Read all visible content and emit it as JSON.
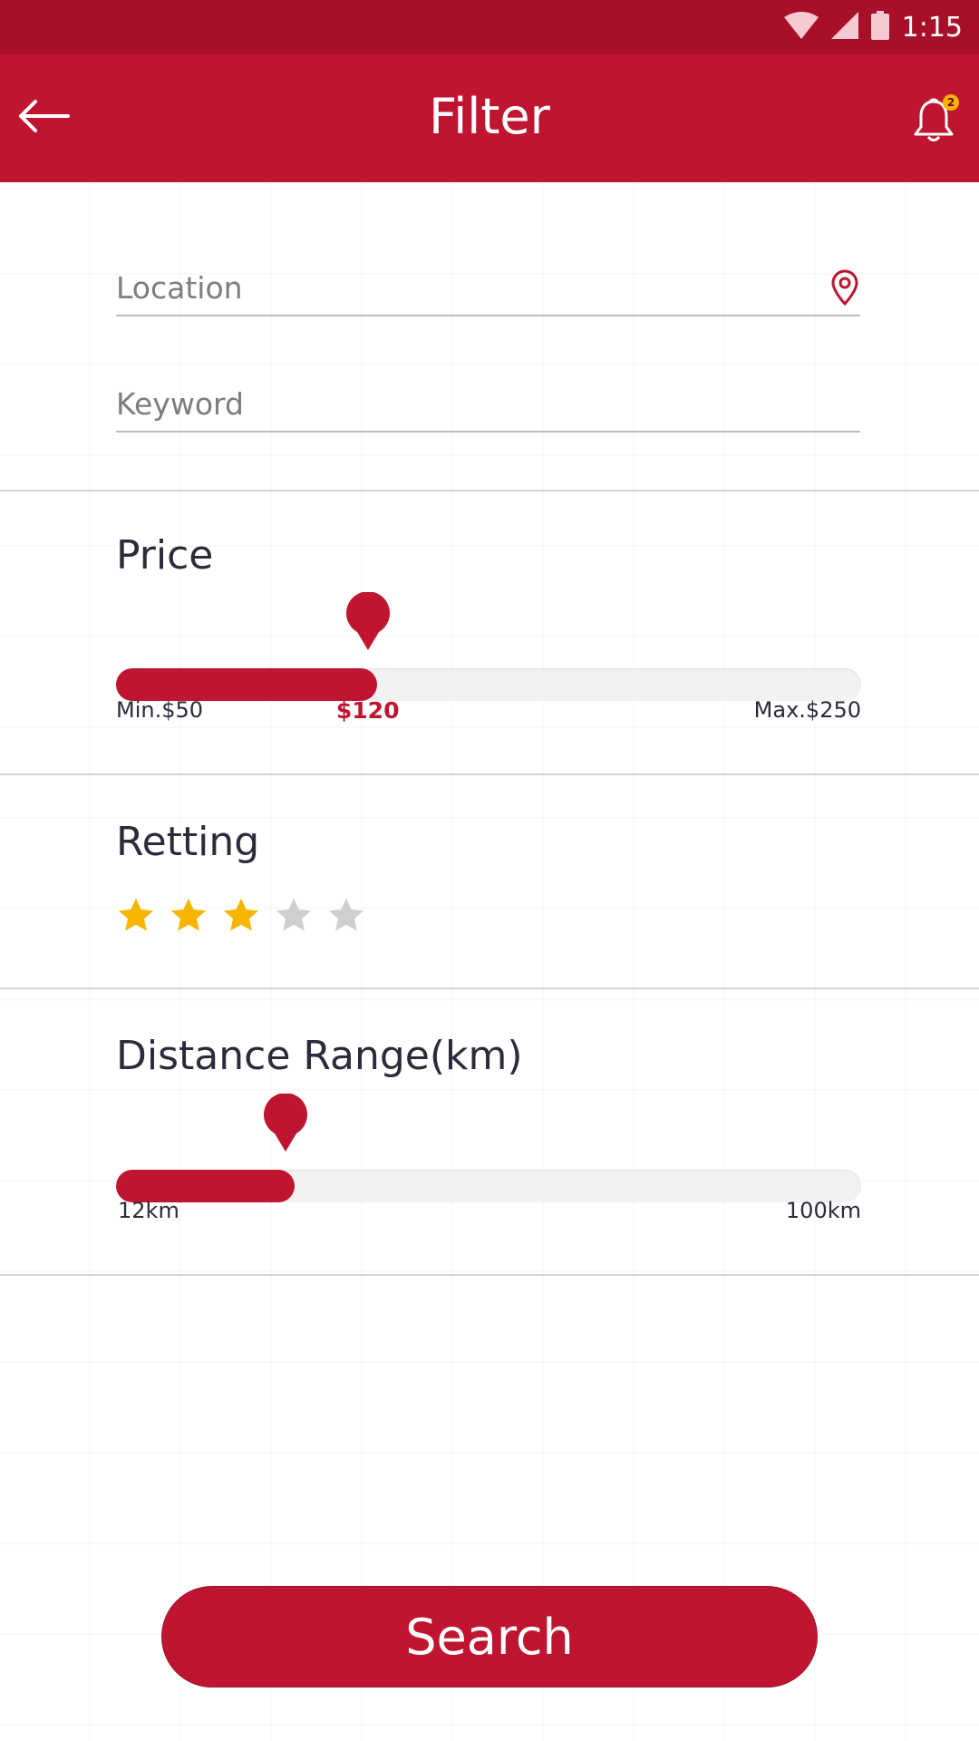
{
  "status_bar": {
    "time": "1:15",
    "icons": [
      "wifi-icon",
      "signal-icon",
      "battery-icon"
    ]
  },
  "app_bar": {
    "title": "Filter",
    "back_icon": "arrow-left-icon",
    "notification_icon": "bell-icon",
    "notification_count": "2"
  },
  "search_fields": {
    "location": {
      "placeholder": "Location",
      "value": "",
      "icon": "location-pin-icon"
    },
    "keyword": {
      "placeholder": "Keyword",
      "value": ""
    }
  },
  "price": {
    "title": "Price",
    "min_label": "Min.$50",
    "max_label": "Max.$250",
    "current_label": "$120",
    "min": 50,
    "max": 250,
    "value": 120
  },
  "rating": {
    "title": "Retting",
    "value": 3,
    "max": 5
  },
  "distance": {
    "title": "Distance Range(km)",
    "min_label": "12km",
    "max_label": "100km",
    "min": 0,
    "max": 100,
    "value": 24
  },
  "search_button": {
    "label": "Search"
  },
  "colors": {
    "primary": "#bf1530",
    "status_bar": "#a8102a",
    "star_filled": "#f7b500",
    "star_empty": "#cfcfcf",
    "track": "#f2f2f2"
  }
}
